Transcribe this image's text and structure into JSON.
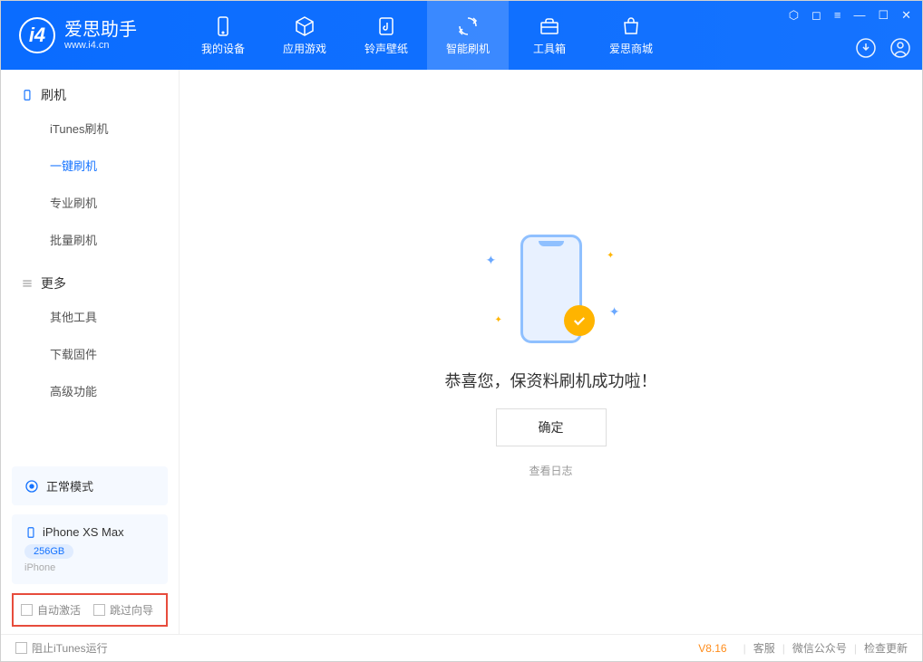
{
  "app": {
    "title": "爱思助手",
    "url": "www.i4.cn"
  },
  "nav": [
    {
      "label": "我的设备"
    },
    {
      "label": "应用游戏"
    },
    {
      "label": "铃声壁纸"
    },
    {
      "label": "智能刷机",
      "active": true
    },
    {
      "label": "工具箱"
    },
    {
      "label": "爱思商城"
    }
  ],
  "sidebar": {
    "section1": "刷机",
    "items1": [
      "iTunes刷机",
      "一键刷机",
      "专业刷机",
      "批量刷机"
    ],
    "section2": "更多",
    "items2": [
      "其他工具",
      "下载固件",
      "高级功能"
    ]
  },
  "device": {
    "mode": "正常模式",
    "name": "iPhone XS Max",
    "storage": "256GB",
    "type": "iPhone"
  },
  "checkboxes": {
    "auto_activate": "自动激活",
    "skip_guide": "跳过向导"
  },
  "main": {
    "success": "恭喜您，保资料刷机成功啦！",
    "confirm": "确定",
    "view_log": "查看日志"
  },
  "footer": {
    "block_itunes": "阻止iTunes运行",
    "version": "V8.16",
    "links": [
      "客服",
      "微信公众号",
      "检查更新"
    ]
  }
}
